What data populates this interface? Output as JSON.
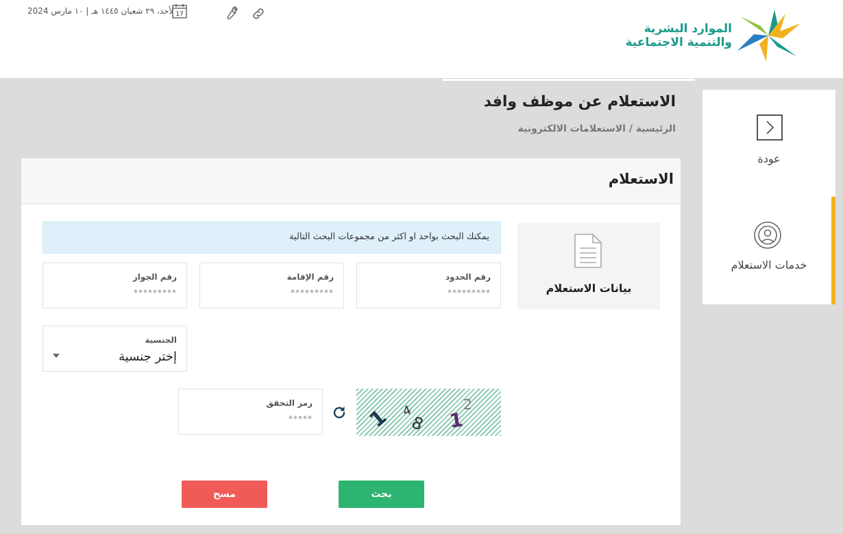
{
  "header": {
    "date_text": "الأحد، ٢٩ شعبان ١٤٤٥ هـ | ١٠ مارس 2024",
    "calendar_day": "17",
    "logo_line1": "الموارد البشرية",
    "logo_line2": "والتنمية الاجتماعية",
    "logo_colors": [
      "#1a9a8a",
      "#f2b21f",
      "#2b7fc1",
      "#8cc63f"
    ]
  },
  "page": {
    "title": "الاستعلام عن موظف وافد",
    "breadcrumb": "الرئيسية / الاستعلامات الالكترونية"
  },
  "sidebar": {
    "back_label": "عودة",
    "services_label": "خدمات الاستعلام",
    "accent_color": "#f2b21f"
  },
  "card": {
    "title": "الاستعلام",
    "info_label": "بيانات الاستعلام",
    "alert_text": "يمكنك البحث بواحد او اكثر من مجموعات البحث التالية"
  },
  "fields": {
    "border_number": {
      "label": "رقم الحدود",
      "placeholder": "*********",
      "value": ""
    },
    "iqama_number": {
      "label": "رقم الإقامة",
      "placeholder": "*********",
      "value": ""
    },
    "passport_number": {
      "label": "رقم الجواز",
      "placeholder": "*********",
      "value": ""
    },
    "nationality": {
      "label": "الجنسية",
      "selected": "إختر جنسية"
    },
    "captcha_code": {
      "label": "رمز التحقق",
      "placeholder": "*****",
      "value": ""
    }
  },
  "captcha": {
    "characters": [
      "2",
      "1",
      "8",
      "4",
      "1"
    ]
  },
  "buttons": {
    "search": "بحث",
    "clear": "مسح",
    "search_color": "#2db470",
    "clear_color": "#f05b57"
  }
}
